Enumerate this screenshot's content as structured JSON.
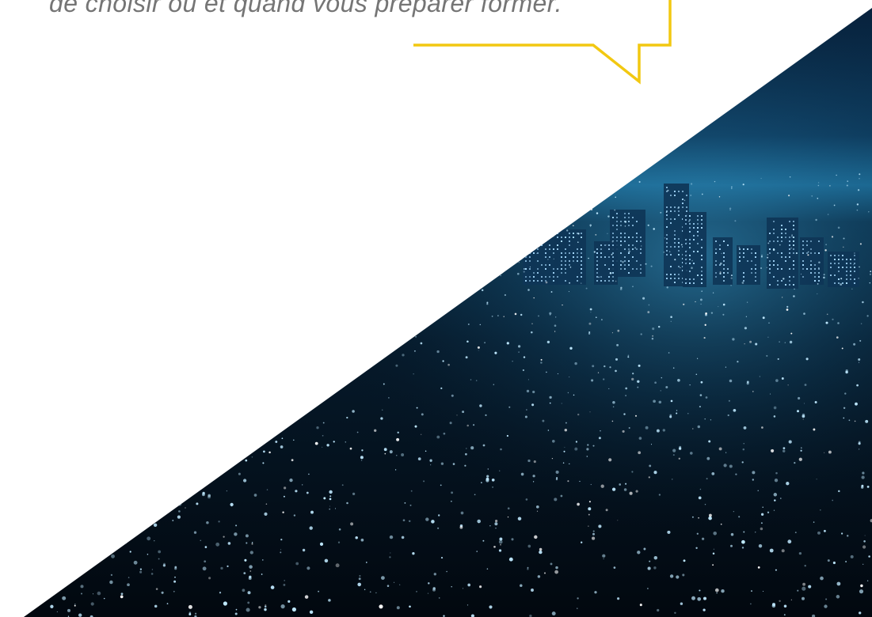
{
  "callout": {
    "quote_text": "de choisir où et quand vous préparer former.",
    "border_color": "#f2c811",
    "text_color": "#757575"
  },
  "photo": {
    "subject": "night city skyline",
    "palette": {
      "sky_top": "#07203a",
      "sky_horizon": "#1d6c96",
      "ground": "#03101c",
      "lights": "#bfe9ff"
    }
  }
}
